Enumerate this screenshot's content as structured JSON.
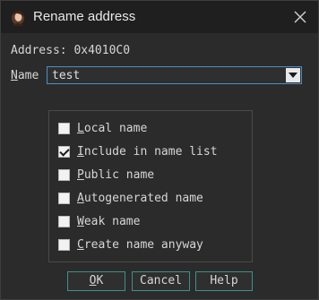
{
  "window": {
    "title": "Rename address",
    "icon": "user-avatar-icon",
    "close_icon": "close-icon"
  },
  "address": {
    "label": "Address:",
    "value": "0x4010C0"
  },
  "name": {
    "label_mnemonic": "N",
    "label_rest": "ame",
    "value": "test",
    "dropdown_icon": "dropdown-arrow-icon"
  },
  "options": [
    {
      "mnemonic": "L",
      "rest": "ocal name",
      "checked": false
    },
    {
      "mnemonic": "I",
      "rest": "nclude in name list",
      "checked": true
    },
    {
      "mnemonic": "P",
      "rest": "ublic name",
      "checked": false
    },
    {
      "mnemonic": "A",
      "rest": "utogenerated name",
      "checked": false
    },
    {
      "mnemonic": "W",
      "rest": "eak name",
      "checked": false
    },
    {
      "mnemonic": "C",
      "rest": "reate name anyway",
      "checked": false
    }
  ],
  "buttons": {
    "ok": {
      "mnemonic": "O",
      "rest": "K"
    },
    "cancel": "Cancel",
    "help": "Help"
  },
  "colors": {
    "background": "#2b2b2b",
    "titlebar": "#1f1f1f",
    "focus_border": "#4a8fc4",
    "button_border": "#3f8f8a",
    "text": "#d6d6d6"
  }
}
